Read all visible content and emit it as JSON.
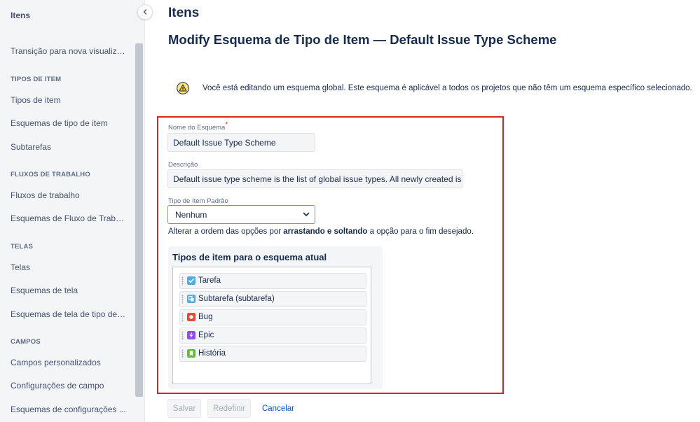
{
  "sidebar": {
    "title": "Itens",
    "link_transition": "Transição para nova visualiza...",
    "sections": [
      {
        "header": "TIPOS DE ITEM",
        "items": [
          "Tipos de item",
          "Esquemas de tipo de item",
          "Subtarefas"
        ]
      },
      {
        "header": "FLUXOS DE TRABALHO",
        "items": [
          "Fluxos de trabalho",
          "Esquemas de Fluxo de Trabal..."
        ]
      },
      {
        "header": "TELAS",
        "items": [
          "Telas",
          "Esquemas de tela",
          "Esquemas de tela de tipo de ..."
        ]
      },
      {
        "header": "CAMPOS",
        "items": [
          "Campos personalizados",
          "Configurações de campo",
          "Esquemas de configurações ..."
        ]
      }
    ]
  },
  "page": {
    "title": "Itens",
    "subtitle": "Modify Esquema de Tipo de Item — Default Issue Type Scheme",
    "warning": "Você está editando um esquema global. Este esquema é aplicável a todos os projetos que não têm um esquema específico selecionado."
  },
  "form": {
    "name_label": "Nome do Esquema",
    "required_mark": "*",
    "name_value": "Default Issue Type Scheme",
    "desc_label": "Descrição",
    "desc_value": "Default issue type scheme is the list of global issue types. All newly created issu",
    "default_label": "Tipo de Item Padrão",
    "default_value": "Nenhum",
    "helper_pre": "Alterar a ordem das opções por ",
    "helper_bold": "arrastando e soltando",
    "helper_post": " a opção para o fim desejado."
  },
  "issue_types": {
    "title": "Tipos de item para o esquema atual",
    "items": [
      {
        "label": "Tarefa",
        "color": "#4bade8",
        "icon": "check-icon"
      },
      {
        "label": "Subtarefa (subtarefa)",
        "color": "#4bade8",
        "icon": "subtask-icon"
      },
      {
        "label": "Bug",
        "color": "#e5493a",
        "icon": "bug-icon"
      },
      {
        "label": "Epic",
        "color": "#904ee2",
        "icon": "lightning-icon"
      },
      {
        "label": "História",
        "color": "#63ba3c",
        "icon": "bookmark-icon"
      }
    ]
  },
  "actions": {
    "save": "Salvar",
    "reset": "Redefinir",
    "cancel": "Cancelar"
  },
  "colors": {
    "highlight_border": "#e01e27",
    "focus_border": "#4c9aff",
    "link": "#0052cc"
  }
}
